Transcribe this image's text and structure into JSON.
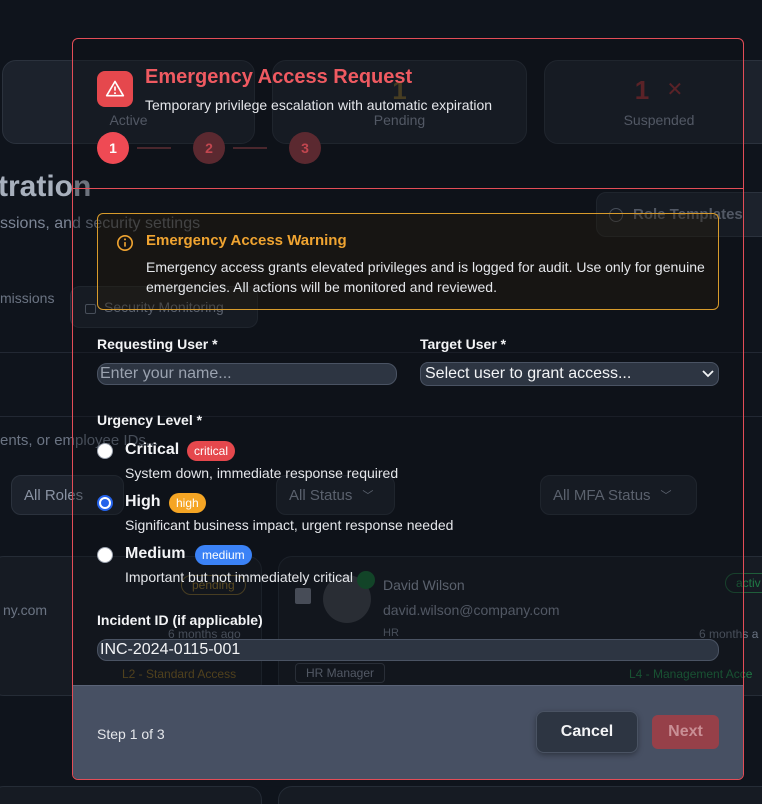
{
  "background": {
    "stats": [
      {
        "value": "",
        "label": "Active"
      },
      {
        "value": "1",
        "label": "Pending"
      },
      {
        "value": "1",
        "label": "Suspended"
      }
    ],
    "page_title": "tration",
    "page_subtitle": "ssions, and security settings",
    "role_templates_label": "Role Templates",
    "tabs": [
      "missions",
      "Security Monitoring"
    ],
    "search_placeholder": "ents, or employee IDs...",
    "filters": {
      "roles": "All Roles",
      "status": "All Status",
      "mfa": "All MFA Status"
    },
    "card_left": {
      "email": "ny.com",
      "time": "6 months ago",
      "badge": "pending",
      "access": "L2 - Standard Access"
    },
    "card_right": {
      "name": "David Wilson",
      "email": "david.wilson@company.com",
      "dept": "HR",
      "time": "6 months a",
      "status": "activ",
      "role": "HR Manager",
      "access": "L4 - Management Acce"
    }
  },
  "modal": {
    "title": "Emergency Access Request",
    "subtitle": "Temporary privilege escalation with automatic expiration",
    "steps": [
      "1",
      "2",
      "3"
    ],
    "warning": {
      "title": "Emergency Access Warning",
      "text": "Emergency access grants elevated privileges and is logged for audit. Use only for genuine emergencies. All actions will be monitored and reviewed."
    },
    "requesting_user": {
      "label": "Requesting User *",
      "placeholder": "Enter your name...",
      "value": ""
    },
    "target_user": {
      "label": "Target User *",
      "selected": "Select user to grant access..."
    },
    "urgency": {
      "label": "Urgency Level *",
      "options": [
        {
          "name": "Critical",
          "badge": "critical",
          "badge_color": "#e5484d",
          "desc": "System down, immediate response required",
          "selected": false
        },
        {
          "name": "High",
          "badge": "high",
          "badge_color": "#f5a524",
          "desc": "Significant business impact, urgent response needed",
          "selected": true
        },
        {
          "name": "Medium",
          "badge": "medium",
          "badge_color": "#3b82f6",
          "desc": "Important but not immediately critical",
          "selected": false
        }
      ]
    },
    "incident": {
      "label": "Incident ID (if applicable)",
      "value": "INC-2024-0115-001"
    },
    "footer": {
      "step_info": "Step 1 of 3",
      "cancel": "Cancel",
      "next": "Next"
    }
  }
}
